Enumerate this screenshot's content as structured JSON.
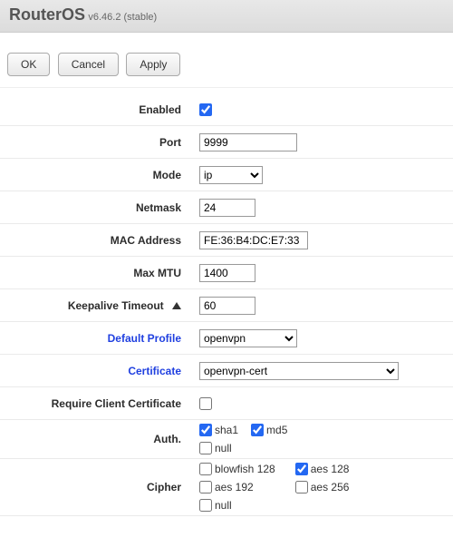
{
  "header": {
    "title": "RouterOS",
    "version": "v6.46.2 (stable)"
  },
  "buttons": {
    "ok": "OK",
    "cancel": "Cancel",
    "apply": "Apply"
  },
  "form": {
    "enabled": {
      "label": "Enabled",
      "checked": true
    },
    "port": {
      "label": "Port",
      "value": "9999"
    },
    "mode": {
      "label": "Mode",
      "value": "ip"
    },
    "netmask": {
      "label": "Netmask",
      "value": "24"
    },
    "mac": {
      "label": "MAC Address",
      "value": "FE:36:B4:DC:E7:33"
    },
    "mtu": {
      "label": "Max MTU",
      "value": "1400"
    },
    "keepalive": {
      "label": "Keepalive Timeout",
      "value": "60"
    },
    "profile": {
      "label": "Default Profile",
      "value": "openvpn"
    },
    "certificate": {
      "label": "Certificate",
      "value": "openvpn-cert"
    },
    "reqclient": {
      "label": "Require Client Certificate",
      "checked": false
    },
    "auth": {
      "label": "Auth.",
      "sha1": {
        "label": "sha1",
        "checked": true
      },
      "md5": {
        "label": "md5",
        "checked": true
      },
      "null": {
        "label": "null",
        "checked": false
      }
    },
    "cipher": {
      "label": "Cipher",
      "bf128": {
        "label": "blowfish 128",
        "checked": false
      },
      "aes128": {
        "label": "aes 128",
        "checked": true
      },
      "aes192": {
        "label": "aes 192",
        "checked": false
      },
      "aes256": {
        "label": "aes 256",
        "checked": false
      },
      "null": {
        "label": "null",
        "checked": false
      }
    }
  }
}
